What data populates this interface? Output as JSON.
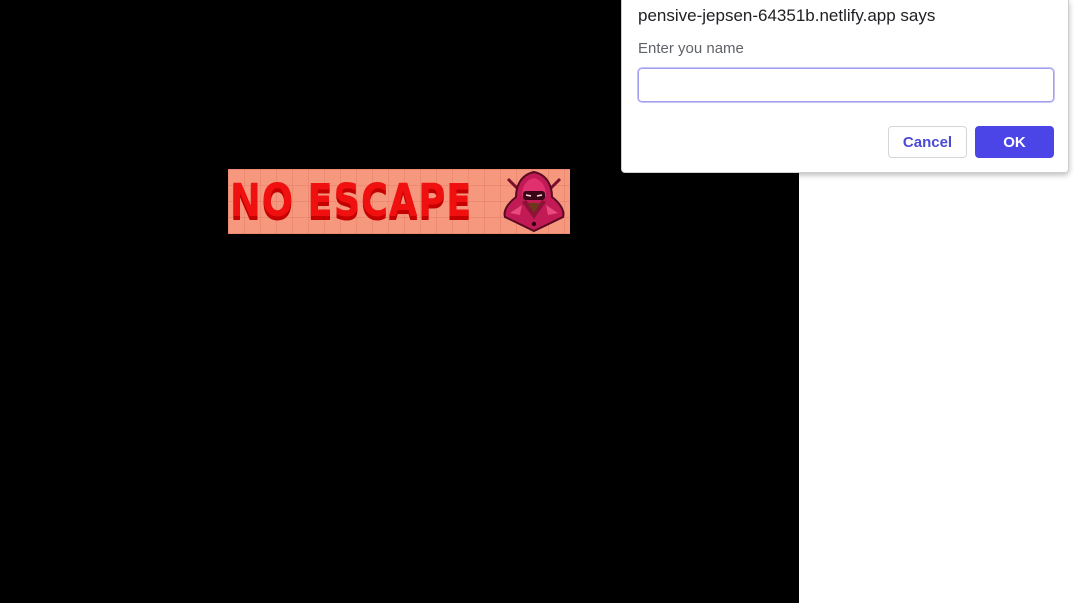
{
  "game": {
    "logo": {
      "title": "NO ESCAPE",
      "mascot_icon": "hooded-ninja-icon"
    }
  },
  "dialog": {
    "title": "pensive-jepsen-64351b.netlify.app says",
    "message": "Enter you name",
    "input_value": "",
    "input_placeholder": "",
    "cancel_label": "Cancel",
    "ok_label": "OK"
  },
  "colors": {
    "canvas_bg": "#000000",
    "logo_bg": "#f6987e",
    "logo_text": "#f01010",
    "ok_button": "#4b45e8",
    "cancel_text": "#4a4ad6"
  }
}
